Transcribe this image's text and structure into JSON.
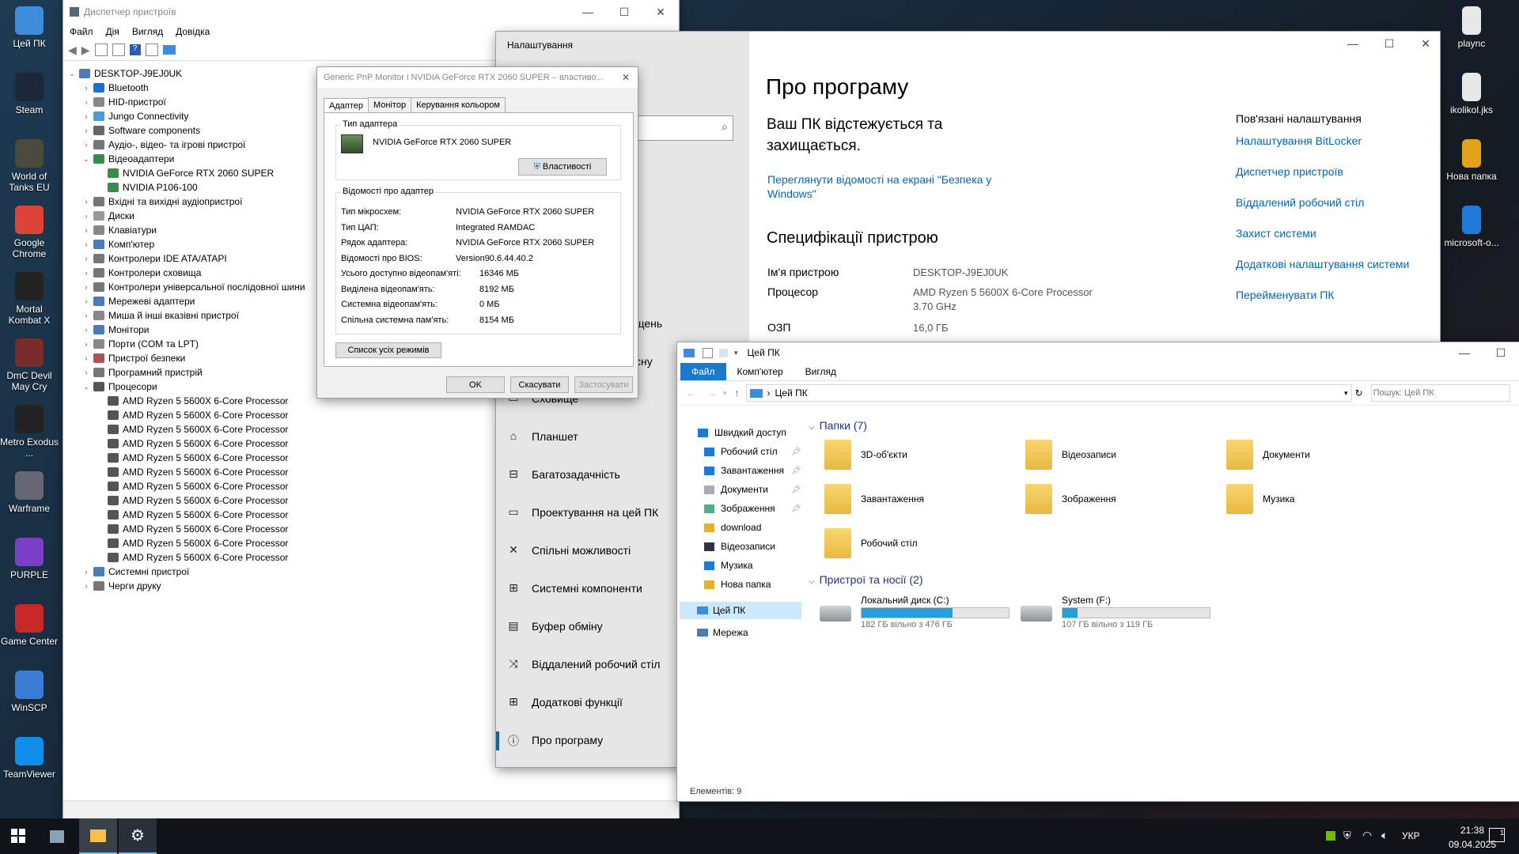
{
  "desktop_left": [
    {
      "label": "Цей ПК",
      "icon": "monitor-icon",
      "color": "#3c8ddc"
    },
    {
      "label": "Steam",
      "icon": "steam-icon",
      "color": "#1b2838"
    },
    {
      "label": "World of Tanks EU",
      "icon": "tank-icon",
      "color": "#4a4a3a"
    },
    {
      "label": "Google Chrome",
      "icon": "chrome-icon",
      "color": "#db4437"
    },
    {
      "label": "Mortal Kombat X",
      "icon": "dragon-icon",
      "color": "#222"
    },
    {
      "label": "DmC Devil May Cry",
      "icon": "dmc-icon",
      "color": "#7a2b2b"
    },
    {
      "label": "Metro Exodus ...",
      "icon": "metro-icon",
      "color": "#222"
    },
    {
      "label": "Warframe",
      "icon": "warframe-icon",
      "color": "#667"
    },
    {
      "label": "PURPLE",
      "icon": "purple-icon",
      "color": "#7b3fc6"
    },
    {
      "label": "Game Center",
      "icon": "gamecenter-icon",
      "color": "#c62828"
    },
    {
      "label": "WinSCP",
      "icon": "winscp-icon",
      "color": "#3a7bd5"
    },
    {
      "label": "TeamViewer",
      "icon": "teamviewer-icon",
      "color": "#0e8ee9"
    }
  ],
  "desktop_right": [
    {
      "label": "plaync",
      "icon": "file-icon",
      "color": "#e8e8e8"
    },
    {
      "label": "ikolikol.jks",
      "icon": "file-icon",
      "color": "#e8e8e8"
    },
    {
      "label": "Нова папка",
      "icon": "folder-icon",
      "color": "#e2a31b"
    },
    {
      "label": "microsoft-o...",
      "icon": "drop-icon",
      "color": "#1e7ad6"
    }
  ],
  "devmgr": {
    "title": "Диспетчер пристроїв",
    "menu": [
      "Файл",
      "Дія",
      "Вигляд",
      "Довідка"
    ],
    "tree": [
      {
        "l": 0,
        "e": "v",
        "t": "DESKTOP-J9EJ0UK",
        "c": "#4a7cb5"
      },
      {
        "l": 1,
        "e": ">",
        "t": "Bluetooth",
        "c": "#1f6fd1"
      },
      {
        "l": 1,
        "e": ">",
        "t": "HID-пристрої",
        "c": "#888"
      },
      {
        "l": 1,
        "e": ">",
        "t": "Jungo Connectivity",
        "c": "#4a9cd6"
      },
      {
        "l": 1,
        "e": ">",
        "t": "Software components",
        "c": "#666"
      },
      {
        "l": 1,
        "e": ">",
        "t": "Аудіо-, відео- та ігрові пристрої",
        "c": "#777"
      },
      {
        "l": 1,
        "e": "v",
        "t": "Відеоадаптери",
        "c": "#3a8a4a"
      },
      {
        "l": 2,
        "e": "",
        "t": "NVIDIA GeForce RTX 2060 SUPER",
        "c": "#3a8a4a"
      },
      {
        "l": 2,
        "e": "",
        "t": "NVIDIA P106-100",
        "c": "#3a8a4a"
      },
      {
        "l": 1,
        "e": ">",
        "t": "Вхідні та вихідні аудіопристрої",
        "c": "#777"
      },
      {
        "l": 1,
        "e": ">",
        "t": "Диски",
        "c": "#999"
      },
      {
        "l": 1,
        "e": ">",
        "t": "Клавіатури",
        "c": "#888"
      },
      {
        "l": 1,
        "e": ">",
        "t": "Комп'ютер",
        "c": "#4a7cb5"
      },
      {
        "l": 1,
        "e": ">",
        "t": "Контролери IDE ATA/ATAPI",
        "c": "#777"
      },
      {
        "l": 1,
        "e": ">",
        "t": "Контролери сховища",
        "c": "#777"
      },
      {
        "l": 1,
        "e": ">",
        "t": "Контролери універсальної послідовної шини",
        "c": "#777"
      },
      {
        "l": 1,
        "e": ">",
        "t": "Мережеві адаптери",
        "c": "#4a7cb5"
      },
      {
        "l": 1,
        "e": ">",
        "t": "Миша й інші вказівні пристрої",
        "c": "#888"
      },
      {
        "l": 1,
        "e": ">",
        "t": "Монітори",
        "c": "#4a7cb5"
      },
      {
        "l": 1,
        "e": ">",
        "t": "Порти (COM та LPT)",
        "c": "#888"
      },
      {
        "l": 1,
        "e": ">",
        "t": "Пристрої безпеки",
        "c": "#a55"
      },
      {
        "l": 1,
        "e": ">",
        "t": "Програмний пристрій",
        "c": "#777"
      },
      {
        "l": 1,
        "e": "v",
        "t": "Процесори",
        "c": "#555"
      },
      {
        "l": 2,
        "e": "",
        "t": "AMD Ryzen 5 5600X 6-Core Processor",
        "c": "#555"
      },
      {
        "l": 2,
        "e": "",
        "t": "AMD Ryzen 5 5600X 6-Core Processor",
        "c": "#555"
      },
      {
        "l": 2,
        "e": "",
        "t": "AMD Ryzen 5 5600X 6-Core Processor",
        "c": "#555"
      },
      {
        "l": 2,
        "e": "",
        "t": "AMD Ryzen 5 5600X 6-Core Processor",
        "c": "#555"
      },
      {
        "l": 2,
        "e": "",
        "t": "AMD Ryzen 5 5600X 6-Core Processor",
        "c": "#555"
      },
      {
        "l": 2,
        "e": "",
        "t": "AMD Ryzen 5 5600X 6-Core Processor",
        "c": "#555"
      },
      {
        "l": 2,
        "e": "",
        "t": "AMD Ryzen 5 5600X 6-Core Processor",
        "c": "#555"
      },
      {
        "l": 2,
        "e": "",
        "t": "AMD Ryzen 5 5600X 6-Core Processor",
        "c": "#555"
      },
      {
        "l": 2,
        "e": "",
        "t": "AMD Ryzen 5 5600X 6-Core Processor",
        "c": "#555"
      },
      {
        "l": 2,
        "e": "",
        "t": "AMD Ryzen 5 5600X 6-Core Processor",
        "c": "#555"
      },
      {
        "l": 2,
        "e": "",
        "t": "AMD Ryzen 5 5600X 6-Core Processor",
        "c": "#555"
      },
      {
        "l": 2,
        "e": "",
        "t": "AMD Ryzen 5 5600X 6-Core Processor",
        "c": "#555"
      },
      {
        "l": 1,
        "e": ">",
        "t": "Системні пристрої",
        "c": "#4a7cb5"
      },
      {
        "l": 1,
        "e": ">",
        "t": "Черги друку",
        "c": "#777"
      }
    ]
  },
  "dialog": {
    "title": "Generic PnP Monitor і NVIDIA GeForce RTX 2060 SUPER – властиво...",
    "tabs": [
      "Адаптер",
      "Монітор",
      "Керування кольором"
    ],
    "adapter_type_label": "Тип адаптера",
    "adapter_name": "NVIDIA GeForce RTX 2060 SUPER",
    "properties_btn": "Властивості",
    "info_label": "Відомості про адаптер",
    "info": [
      [
        "Тип мікросхем:",
        "NVIDIA GeForce RTX 2060 SUPER"
      ],
      [
        "Тип ЦАП:",
        "Integrated RAMDAC"
      ],
      [
        "Рядок адаптера:",
        "NVIDIA GeForce RTX 2060 SUPER"
      ],
      [
        "Відомості про BIOS:",
        "Version90.6.44.40.2"
      ]
    ],
    "mem": [
      [
        "Усього доступно відеопам'яті:",
        "16346 МБ"
      ],
      [
        "Виділена відеопам'ять:",
        "8192 МБ"
      ],
      [
        "Системна відеопам'ять:",
        "0 МБ"
      ],
      [
        "Спільна системна пам'ять:",
        "8154 МБ"
      ]
    ],
    "list_modes_btn": "Список усіх режимів",
    "ok": "OK",
    "cancel": "Скасувати",
    "apply": "Застосувати"
  },
  "settings": {
    "title": "Налаштування",
    "partial_1": "щень",
    "partial_2": "сну",
    "nav": [
      {
        "t": "Сховище",
        "i": "▭"
      },
      {
        "t": "Планшет",
        "i": "⌂"
      },
      {
        "t": "Багатозадачність",
        "i": "⊟"
      },
      {
        "t": "Проектування на цей ПК",
        "i": "▭"
      },
      {
        "t": "Спільні можливості",
        "i": "✕"
      },
      {
        "t": "Системні компоненти",
        "i": "⊞"
      },
      {
        "t": "Буфер обміну",
        "i": "▤"
      },
      {
        "t": "Віддалений робочий стіл",
        "i": "⤨"
      },
      {
        "t": "Додаткові функції",
        "i": "⊞"
      },
      {
        "t": "Про програму",
        "i": "ⓘ"
      }
    ],
    "page_title": "Про програму",
    "protected": "Ваш ПК відстежується та захищається.",
    "security_link": "Переглянути відомості на екрані \"Безпека у Windows\"",
    "specs_title": "Специфікації пристрою",
    "specs": [
      [
        "Ім'я пристрою",
        "DESKTOP-J9EJ0UK"
      ],
      [
        "Процесор",
        "AMD Ryzen 5 5600X 6-Core Processor 3.70 GHz"
      ],
      [
        "ОЗП",
        "16,0 ГБ"
      ]
    ],
    "related_title": "Пов'язані налаштування",
    "related": [
      "Налаштування BitLocker",
      "Диспетчер пристроїв",
      "Віддалений робочий стіл",
      "Захист системи",
      "Додаткові налаштування системи",
      "Перейменувати ПК"
    ]
  },
  "explorer": {
    "title": "Цей ПК",
    "ribbon": [
      "Файл",
      "Комп'ютер",
      "Вигляд"
    ],
    "address": "Цей ПК",
    "search_placeholder": "Пошук: Цей ПК",
    "nav": [
      {
        "t": "Швидкий доступ",
        "c": "#1e7ad6",
        "pin": false,
        "ind": 0
      },
      {
        "t": "Робочий стіл",
        "c": "#1e7ad6",
        "pin": true,
        "ind": 1
      },
      {
        "t": "Завантаження",
        "c": "#1e7ad6",
        "pin": true,
        "ind": 1
      },
      {
        "t": "Документи",
        "c": "#aab",
        "pin": true,
        "ind": 1
      },
      {
        "t": "Зображення",
        "c": "#5a8",
        "pin": true,
        "ind": 1
      },
      {
        "t": "download",
        "c": "#e2b035",
        "pin": false,
        "ind": 1
      },
      {
        "t": "Відеозаписи",
        "c": "#334",
        "pin": false,
        "ind": 1
      },
      {
        "t": "Музика",
        "c": "#1e7ad6",
        "pin": false,
        "ind": 1
      },
      {
        "t": "Нова папка",
        "c": "#e2b035",
        "pin": false,
        "ind": 1
      }
    ],
    "this_pc": "Цей ПК",
    "network": "Мережа",
    "folders_header": "Папки (7)",
    "folders": [
      "3D-об'єкти",
      "Відеозаписи",
      "Документи",
      "Завантаження",
      "Зображення",
      "Музика",
      "Робочий стіл"
    ],
    "devices_header": "Пристрої та носії (2)",
    "drives": [
      {
        "name": "Локальний диск (C:)",
        "free": "182 ГБ вільно з 476 ГБ",
        "used_fraction": 0.62
      },
      {
        "name": "System (F:)",
        "free": "107 ГБ вільно з 119 ГБ",
        "used_fraction": 0.1
      }
    ],
    "status": "Елементів: 9"
  },
  "taskbar": {
    "lang": "УКР",
    "time": "21:38",
    "date": "09.04.2025",
    "notif_count": "1"
  }
}
